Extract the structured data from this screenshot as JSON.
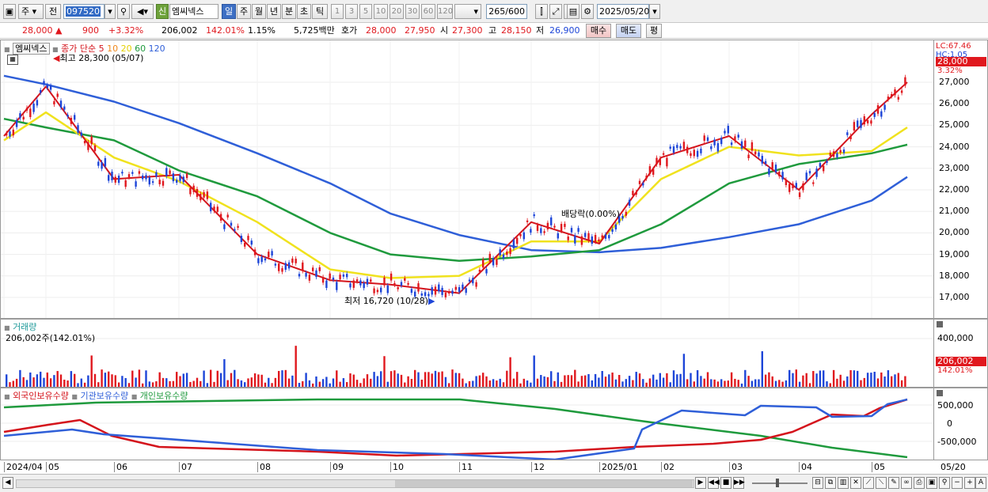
{
  "toolbar": {
    "market": "주",
    "prev_label": "전",
    "code": "097520",
    "new_badge": "신",
    "stock_name": "엠씨넥스",
    "periods": [
      "일",
      "주",
      "월",
      "년",
      "분",
      "초",
      "틱"
    ],
    "intervals": [
      "1",
      "3",
      "5",
      "10",
      "20",
      "30",
      "60",
      "120"
    ],
    "count": "265",
    "max_count": "/600",
    "date": "2025/05/20"
  },
  "quote": {
    "price": "28,000",
    "change": "900",
    "change_pct": "+3.32%",
    "volume": "206,002",
    "volume_ratio": "142.01%",
    "turnover": "1.15%",
    "amount": "5,725백만",
    "ask_label": "호가",
    "ask": "28,000",
    "bid": "27,950",
    "open_label": "시",
    "open": "27,300",
    "high_label": "고",
    "high": "28,150",
    "low_label": "저",
    "low": "26,900",
    "buy_label": "매수",
    "sell_label": "매도",
    "avg_label": "평"
  },
  "price_panel": {
    "stock_label": "엠씨넥스",
    "ma_title": "종가 단순",
    "ma_periods": [
      "5",
      "10",
      "20",
      "60",
      "120"
    ],
    "ma_colors": [
      "#d4141c",
      "#f0891d",
      "#f0e21e",
      "#1f9a3d",
      "#2f5fd8"
    ],
    "high_marker": "최고 28,300 (05/07)",
    "low_marker": "최저 16,720 (10/28)",
    "ex_div_label": "배당락(0.00%)",
    "lc_label": "LC:67.46",
    "hc_label": "HC:1.05",
    "current_price_tag": "28,000",
    "current_pct_tag": "3.32%",
    "y_ticks": [
      "27,000",
      "26,000",
      "25,000",
      "24,000",
      "23,000",
      "22,000",
      "21,000",
      "20,000",
      "19,000",
      "18,000",
      "17,000"
    ]
  },
  "volume_panel": {
    "title": "거래량",
    "value": "206,002주(142.01%)",
    "y_tick": "400,000",
    "tag_value": "206,002",
    "tag_pct": "142.01%"
  },
  "holding_panel": {
    "series": [
      "외국인보유수량",
      "기관보유수량",
      "개인보유수량"
    ],
    "series_colors": [
      "#d4141c",
      "#2f5fd8",
      "#1f9a3d"
    ],
    "y_ticks": [
      "500,000",
      "0",
      "-500,000"
    ]
  },
  "x_axis": {
    "labels": [
      "2024/04",
      "05",
      "06",
      "07",
      "08",
      "09",
      "10",
      "11",
      "12",
      "2025/01",
      "02",
      "03",
      "04",
      "05"
    ],
    "end_label": "05/20"
  },
  "chart_data": {
    "type": "line",
    "y_scale": "linear",
    "ylim": [
      16300,
      28300
    ],
    "series": [
      {
        "name": "5",
        "x": [
          "2024/04",
          "05",
          "06",
          "07",
          "08",
          "09",
          "10",
          "11",
          "12",
          "2025/01",
          "02",
          "03",
          "04",
          "05",
          "05/20"
        ],
        "values": [
          24500,
          26800,
          22500,
          22700,
          19000,
          17800,
          17600,
          17200,
          20500,
          19500,
          23500,
          24500,
          22000,
          25500,
          27000
        ]
      },
      {
        "name": "20",
        "x": [
          "2024/04",
          "05",
          "06",
          "07",
          "08",
          "09",
          "10",
          "11",
          "12",
          "2025/01",
          "02",
          "03",
          "04",
          "05",
          "05/20"
        ],
        "values": [
          24300,
          25600,
          23500,
          22400,
          20500,
          18300,
          17900,
          18000,
          19600,
          19600,
          22500,
          24000,
          23600,
          23800,
          24900
        ]
      },
      {
        "name": "60",
        "x": [
          "2024/04",
          "05",
          "06",
          "07",
          "08",
          "09",
          "10",
          "11",
          "12",
          "2025/01",
          "02",
          "03",
          "04",
          "05",
          "05/20"
        ],
        "values": [
          25300,
          24900,
          24300,
          22900,
          21700,
          20000,
          19000,
          18700,
          18900,
          19200,
          20400,
          22300,
          23200,
          23700,
          24100
        ]
      },
      {
        "name": "120",
        "x": [
          "2024/04",
          "05",
          "06",
          "07",
          "08",
          "09",
          "10",
          "11",
          "12",
          "2025/01",
          "02",
          "03",
          "04",
          "05",
          "05/20"
        ],
        "values": [
          27300,
          26900,
          26100,
          25100,
          23700,
          22300,
          20900,
          19900,
          19200,
          19100,
          19300,
          19800,
          20400,
          21500,
          22600
        ]
      }
    ],
    "annotations": [
      "최고 28,300 (05/07)",
      "최저 16,720 (10/28)",
      "배당락(0.00%)"
    ]
  }
}
